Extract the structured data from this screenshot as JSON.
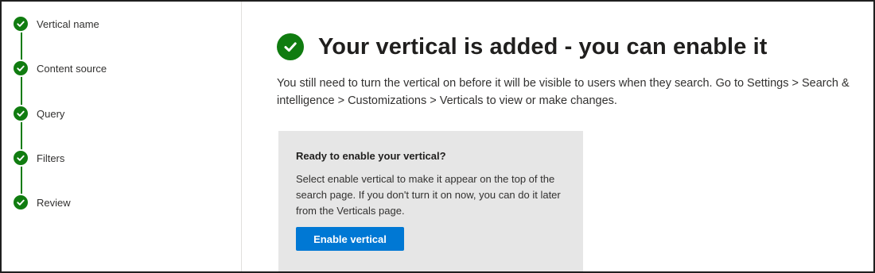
{
  "wizard": {
    "steps": [
      {
        "label": "Vertical name",
        "status": "complete"
      },
      {
        "label": "Content source",
        "status": "complete"
      },
      {
        "label": "Query",
        "status": "complete"
      },
      {
        "label": "Filters",
        "status": "complete"
      },
      {
        "label": "Review",
        "status": "complete"
      }
    ]
  },
  "main": {
    "title": "Your vertical is added - you can enable it",
    "description": "You still need to turn the vertical on before it will be visible to users when they search. Go to Settings > Search & intelligence > Customizations > Verticals to view or make changes.",
    "card": {
      "title": "Ready to enable your vertical?",
      "body": "Select enable vertical to make it appear on the top of the search page. If you don't turn it on now, you can do it later from the Verticals page.",
      "button_label": "Enable vertical"
    }
  },
  "colors": {
    "success_green": "#107c10",
    "primary_blue": "#0078d4",
    "card_background": "#e6e6e6"
  },
  "icons": {
    "step_status": "checkmark-circle-icon",
    "success": "checkmark-circle-icon"
  }
}
